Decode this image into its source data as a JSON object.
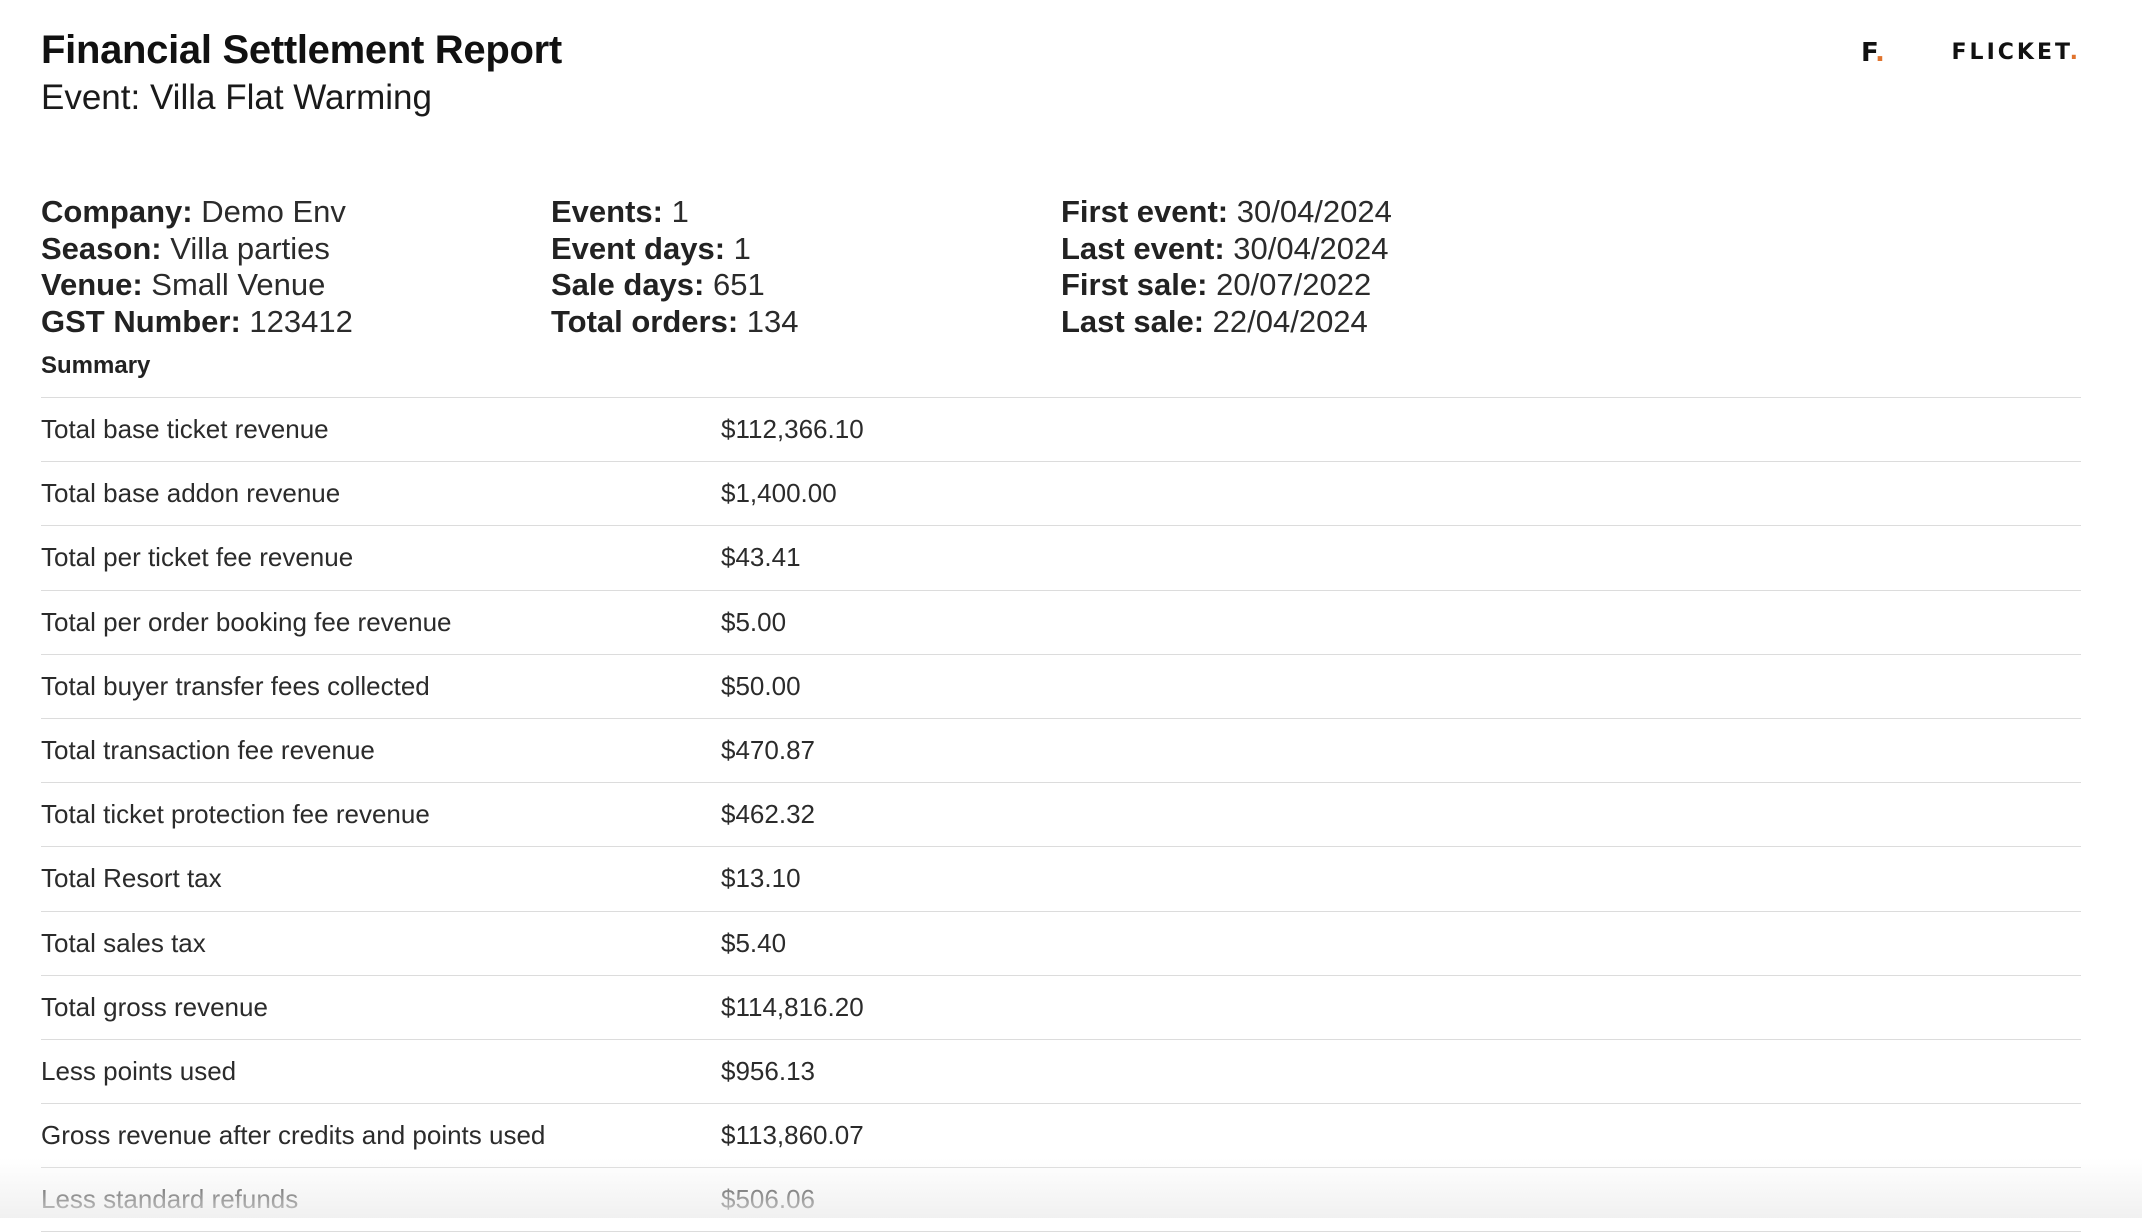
{
  "header": {
    "title": "Financial Settlement Report",
    "event_label": "Event:",
    "event_name": "Villa Flat Warming"
  },
  "logo": {
    "mark_letter": "F",
    "mark_dot": ".",
    "wordmark": "FLICKET",
    "wordmark_dot": ".",
    "accent_color": "#e0732d"
  },
  "meta": {
    "company": {
      "label": "Company:",
      "value": "Demo Env"
    },
    "season": {
      "label": "Season:",
      "value": "Villa parties"
    },
    "venue": {
      "label": "Venue:",
      "value": "Small Venue"
    },
    "gst_number": {
      "label": "GST Number:",
      "value": "123412"
    },
    "events": {
      "label": "Events:",
      "value": "1"
    },
    "event_days": {
      "label": "Event days:",
      "value": "1"
    },
    "sale_days": {
      "label": "Sale days:",
      "value": "651"
    },
    "total_orders": {
      "label": "Total orders:",
      "value": "134"
    },
    "first_event": {
      "label": "First event:",
      "value": "30/04/2024"
    },
    "last_event": {
      "label": "Last event:",
      "value": "30/04/2024"
    },
    "first_sale": {
      "label": "First sale:",
      "value": "20/07/2022"
    },
    "last_sale": {
      "label": "Last sale:",
      "value": "22/04/2024"
    }
  },
  "summary": {
    "heading": "Summary",
    "rows": [
      {
        "label": "Total base ticket revenue",
        "value": "$112,366.10"
      },
      {
        "label": "Total base addon revenue",
        "value": "$1,400.00"
      },
      {
        "label": "Total per ticket fee revenue",
        "value": "$43.41"
      },
      {
        "label": "Total per order booking fee revenue",
        "value": "$5.00"
      },
      {
        "label": "Total buyer transfer fees collected",
        "value": "$50.00"
      },
      {
        "label": "Total transaction fee revenue",
        "value": "$470.87"
      },
      {
        "label": "Total ticket protection fee revenue",
        "value": "$462.32"
      },
      {
        "label": "Total Resort tax",
        "value": "$13.10"
      },
      {
        "label": "Total sales tax",
        "value": "$5.40"
      },
      {
        "label": "Total gross revenue",
        "value": "$114,816.20"
      },
      {
        "label": "Less points used",
        "value": "$956.13"
      },
      {
        "label": "Gross revenue after credits and points used",
        "value": "$113,860.07"
      },
      {
        "label": "Less standard refunds",
        "value": "$506.06"
      }
    ]
  }
}
